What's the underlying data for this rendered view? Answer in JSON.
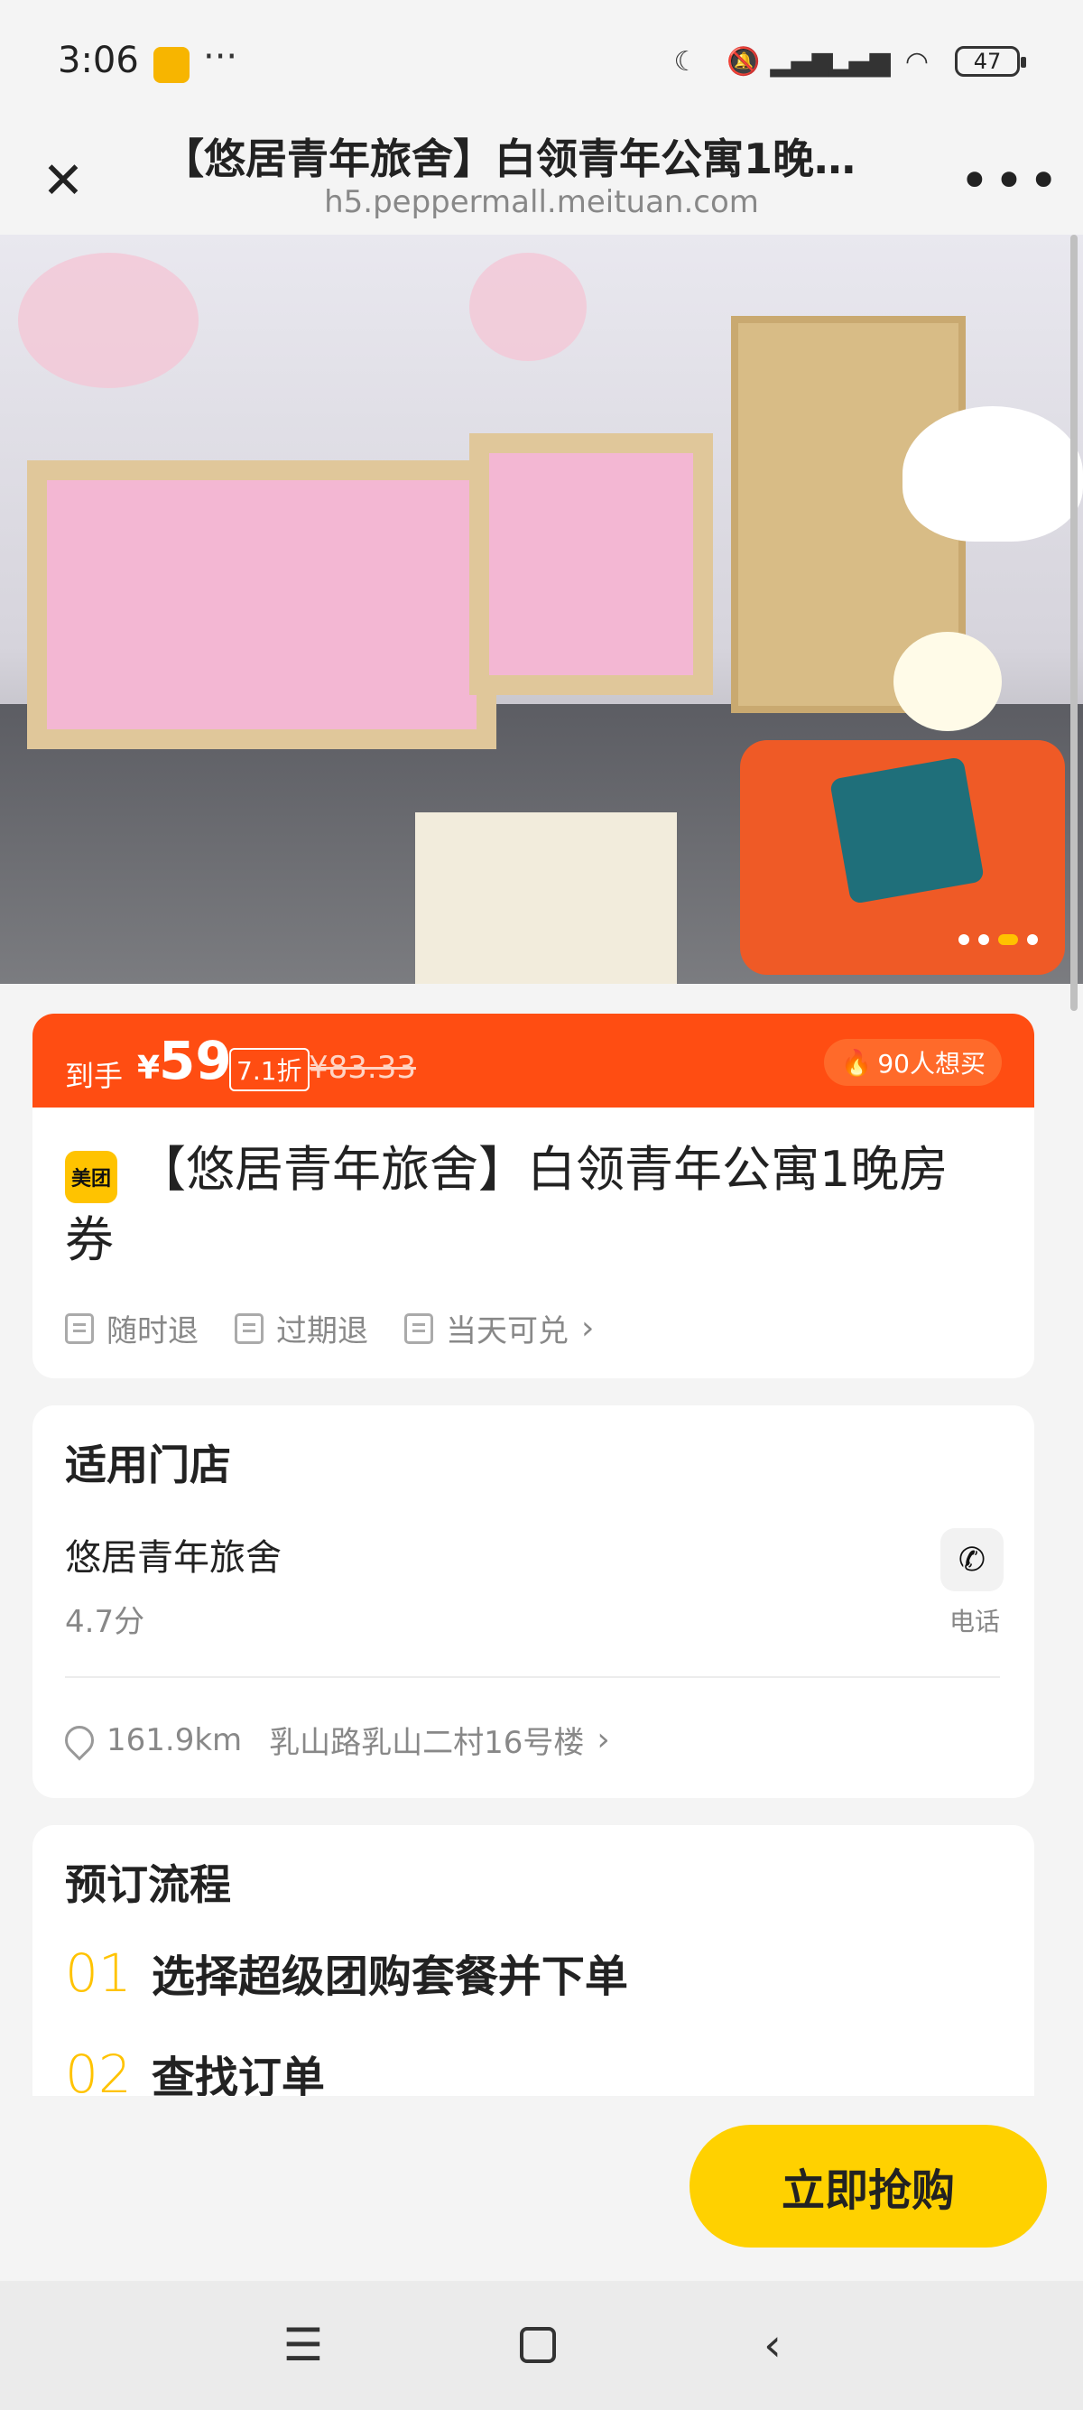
{
  "status_bar": {
    "time": "3:06",
    "more": "···",
    "battery": "47",
    "icons": [
      "moon-icon",
      "mute-icon",
      "signal-icon",
      "signal-icon",
      "wifi-icon"
    ]
  },
  "browser": {
    "title": "【悠居青年旅舍】白领青年公寓1晚…",
    "url": "h5.peppermall.meituan.com"
  },
  "hero": {
    "dots": 4,
    "active_dot": 3
  },
  "price": {
    "label": "到手",
    "currency": "¥",
    "value": "59",
    "discount": "7.1折",
    "original": "¥83.33",
    "want": "90人想买"
  },
  "product": {
    "brand": "美团",
    "title": "【悠居青年旅舍】白领青年公寓1晚房券",
    "tags": [
      "随时退",
      "过期退",
      "当天可兑"
    ]
  },
  "store": {
    "section_title": "适用门店",
    "name": "悠居青年旅舍",
    "rating": "4.7分",
    "phone_label": "电话",
    "distance": "161.9km",
    "address": "乳山路乳山二村16号楼"
  },
  "booking": {
    "section_title": "预订流程",
    "steps": [
      {
        "num": "01",
        "text": "选择超级团购套餐并下单"
      },
      {
        "num": "02",
        "text": "查找订单"
      }
    ]
  },
  "actions": {
    "buy": "立即抢购"
  },
  "colors": {
    "accent": "#ff4d12",
    "buy_button": "#ffd100",
    "brand": "#ffc300"
  }
}
